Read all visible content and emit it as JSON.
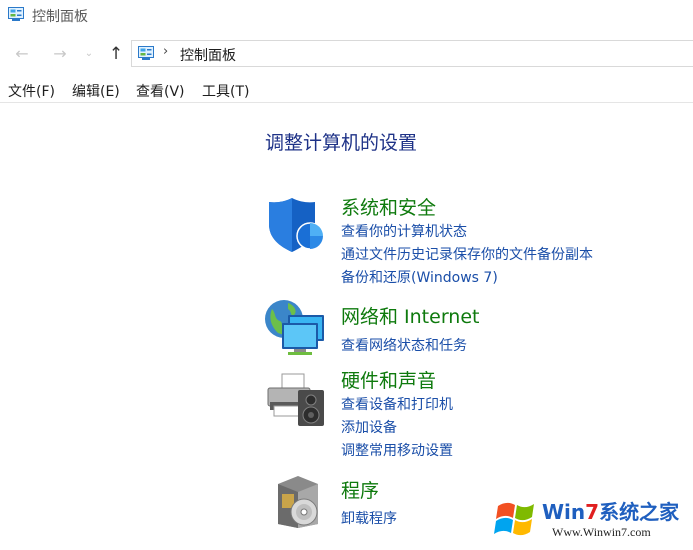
{
  "window": {
    "title": "控制面板"
  },
  "navigation": {
    "back_icon": "arrow-left-icon",
    "forward_icon": "arrow-right-icon",
    "recent_icon": "chevron-down-icon",
    "up_icon": "arrow-up-icon",
    "address": {
      "separator": "›",
      "path": "控制面板"
    }
  },
  "menu": {
    "items": [
      "文件(F)",
      "编辑(E)",
      "查看(V)",
      "工具(T)"
    ]
  },
  "main": {
    "title": "调整计算机的设置",
    "categories": [
      {
        "icon": "shield-icon",
        "title": "系统和安全",
        "links": [
          "查看你的计算机状态",
          "通过文件历史记录保存你的文件备份副本",
          "备份和还原(Windows 7)"
        ]
      },
      {
        "icon": "network-globe-icon",
        "title": "网络和 Internet",
        "links": [
          "查看网络状态和任务"
        ]
      },
      {
        "icon": "printer-speaker-icon",
        "title": "硬件和声音",
        "links": [
          "查看设备和打印机",
          "添加设备",
          "调整常用移动设置"
        ]
      },
      {
        "icon": "programs-disc-icon",
        "title": "程序",
        "links": [
          "卸载程序"
        ]
      }
    ]
  },
  "watermark": {
    "name_part1": "Win",
    "name_part2": "7",
    "name_part3": "系统之家",
    "url": "Www.Winwin7.com"
  },
  "colors": {
    "page_title": "#1e3287",
    "category_title": "#0e7a0d",
    "link": "#1a4ea8",
    "watermark_blue": "#1f5fbf",
    "watermark_red": "#e02020"
  }
}
